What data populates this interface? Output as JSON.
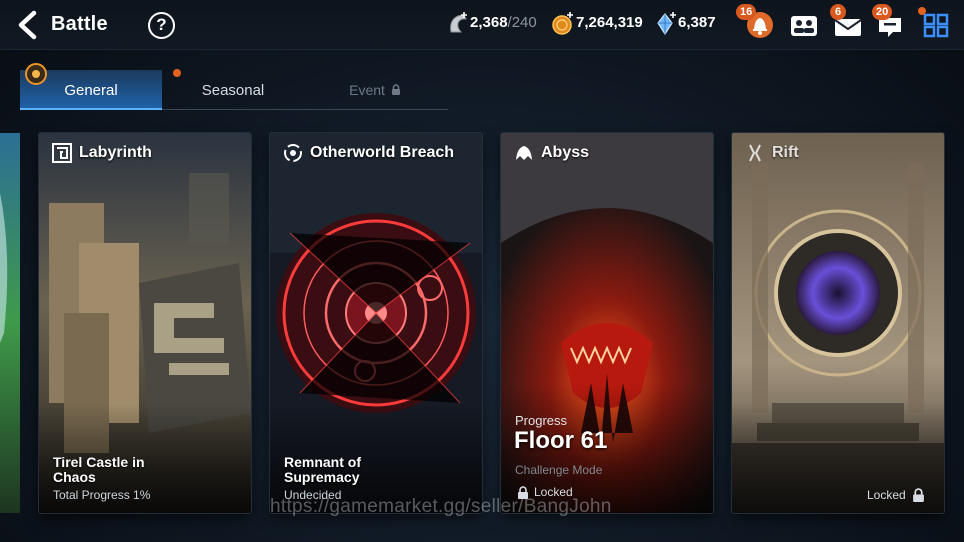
{
  "header": {
    "back_icon": "chevron-left-icon",
    "title": "Battle",
    "help_label": "?",
    "resources": [
      {
        "name": "stamina",
        "icon": "stamina-icon",
        "value": "2,368",
        "max": "/240"
      },
      {
        "name": "gold",
        "icon": "gold-coin-icon",
        "value": "7,264,319"
      },
      {
        "name": "skystone",
        "icon": "crystal-icon",
        "value": "6,387"
      }
    ],
    "notifications": {
      "bell_badge": "16",
      "mail_badge": "6",
      "chat_badge": "20"
    }
  },
  "tabs": [
    {
      "label": "General",
      "active": true
    },
    {
      "label": "Seasonal",
      "active": false
    },
    {
      "label": "Event",
      "locked": true
    }
  ],
  "cards": [
    {
      "name": "Labyrinth",
      "icon": "maze-icon",
      "subtitle_line1": "Tirel Castle in",
      "subtitle_line2": "Chaos",
      "meta": "Total Progress 1%"
    },
    {
      "name": "Otherworld Breach",
      "icon": "portal-swirl-icon",
      "subtitle_line1": "Remnant of",
      "subtitle_line2": "Supremacy",
      "meta": "Undecided"
    },
    {
      "name": "Abyss",
      "icon": "abyss-claw-icon",
      "progress_label": "Progress",
      "floor": "Floor 61",
      "mode": "Challenge Mode",
      "lock_text": "Locked"
    },
    {
      "name": "Rift",
      "icon": "rift-icon",
      "lock_text": "Locked"
    }
  ],
  "watermark": "https://gamemarket.gg/seller/BangJohn",
  "colors": {
    "accent_orange": "#e3621f",
    "tab_active": "#1f62a8",
    "badge": "#d9581e"
  }
}
